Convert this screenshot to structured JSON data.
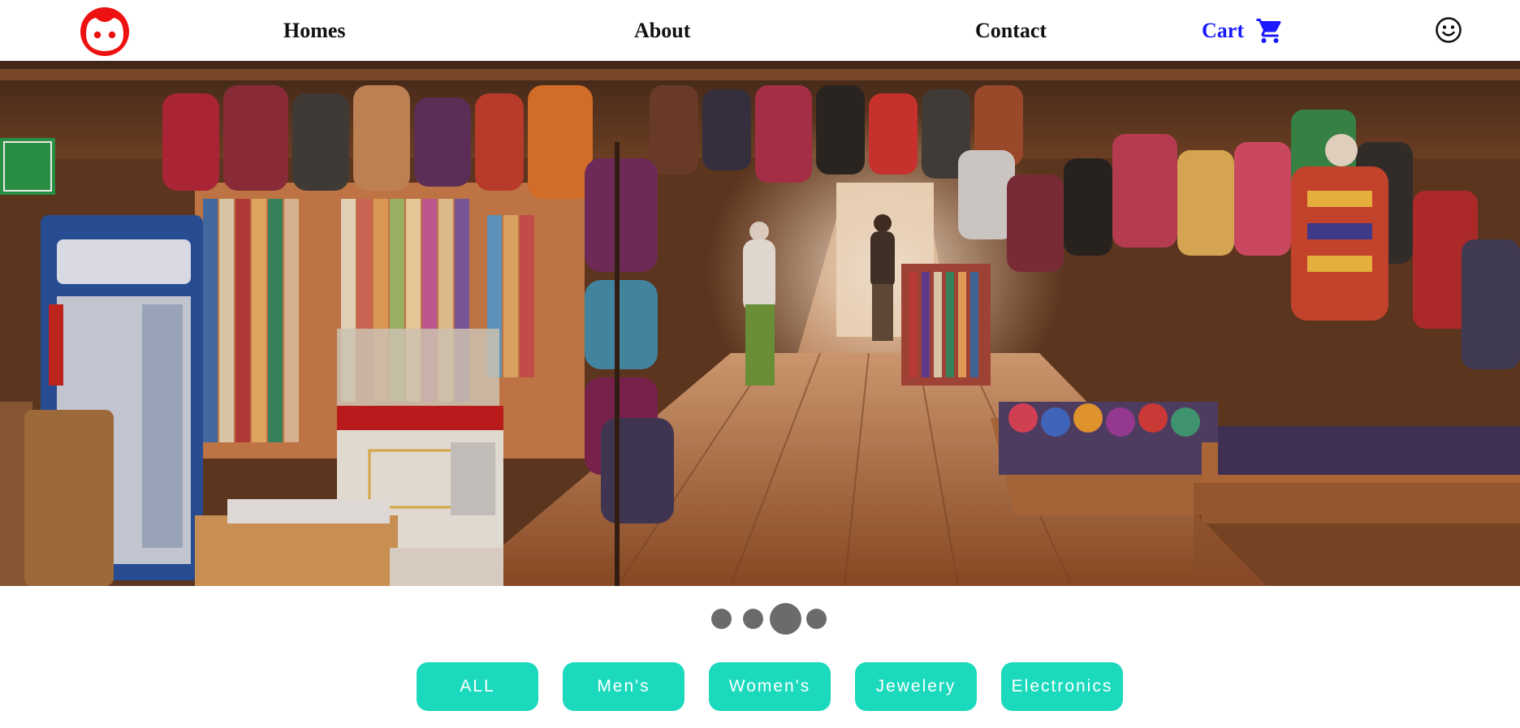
{
  "nav": {
    "logo_icon": "cartoon-face-logo-icon",
    "links": [
      {
        "label": "Homes"
      },
      {
        "label": "About"
      },
      {
        "label": "Contact"
      }
    ],
    "cart": {
      "label": "Cart",
      "icon": "shopping-cart-icon",
      "color": "#1a1aff"
    },
    "user_icon": "smiley-face-icon"
  },
  "hero": {
    "image_icon": "market-stall-photo"
  },
  "carousel": {
    "slide_count": 4,
    "active_index": 2
  },
  "categories": [
    {
      "label": "ALL"
    },
    {
      "label": "Men's"
    },
    {
      "label": "Women's"
    },
    {
      "label": "Jewelery"
    },
    {
      "label": "Electronics"
    }
  ],
  "colors": {
    "accent": "#1ad9bd",
    "logo_red": "#ee1111",
    "dot": "#6b6b6b"
  }
}
